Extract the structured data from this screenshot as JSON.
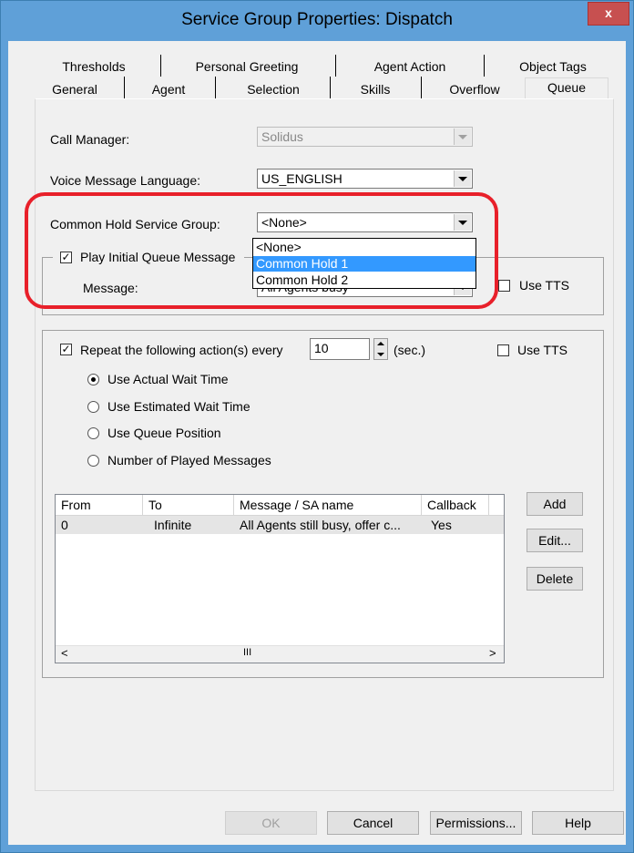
{
  "window": {
    "title": "Service Group Properties: Dispatch",
    "close_label": "x"
  },
  "tabs_row1": [
    "Thresholds",
    "Personal Greeting",
    "Agent Action",
    "Object Tags"
  ],
  "tabs_row2": [
    "General",
    "Agent",
    "Selection",
    "Skills",
    "Overflow",
    "Queue"
  ],
  "active_tab": "Queue",
  "fields": {
    "call_manager": {
      "label": "Call Manager:",
      "value": "Solidus"
    },
    "voice_language": {
      "label": "Voice Message Language:",
      "value": "US_ENGLISH"
    },
    "common_hold": {
      "label": "Common Hold Service Group:",
      "value": "<None>",
      "options": [
        "<None>",
        "Common Hold 1",
        "Common Hold 2"
      ],
      "highlighted": "Common Hold 1"
    }
  },
  "initial_queue": {
    "checkbox_label": "Play Initial Queue Message",
    "message_label": "Message:",
    "message_value": "All Agents busy",
    "tts_label": "Use TTS"
  },
  "repeat": {
    "checkbox_label": "Repeat the following action(s) every",
    "interval": "10",
    "unit": "(sec.)",
    "tts_label": "Use TTS",
    "options": [
      "Use Actual Wait Time",
      "Use Estimated Wait Time",
      "Use Queue Position",
      "Number of Played Messages"
    ],
    "selected": "Use Actual Wait Time"
  },
  "table": {
    "columns": [
      "From",
      "To",
      "Message / SA name",
      "Callback"
    ],
    "rows": [
      {
        "from": "0",
        "to": "Infinite",
        "message": "All Agents still busy, offer c...",
        "callback": "Yes"
      }
    ],
    "scroll_left": "<",
    "scroll_thumb": "III",
    "scroll_right": ">"
  },
  "side_buttons": {
    "add": "Add",
    "edit": "Edit...",
    "delete": "Delete"
  },
  "footer": {
    "ok": "OK",
    "cancel": "Cancel",
    "permissions": "Permissions...",
    "help": "Help"
  },
  "colors": {
    "title_bar": "#5fa0d8",
    "selection": "#3399ff",
    "callout": "#e8202a"
  }
}
